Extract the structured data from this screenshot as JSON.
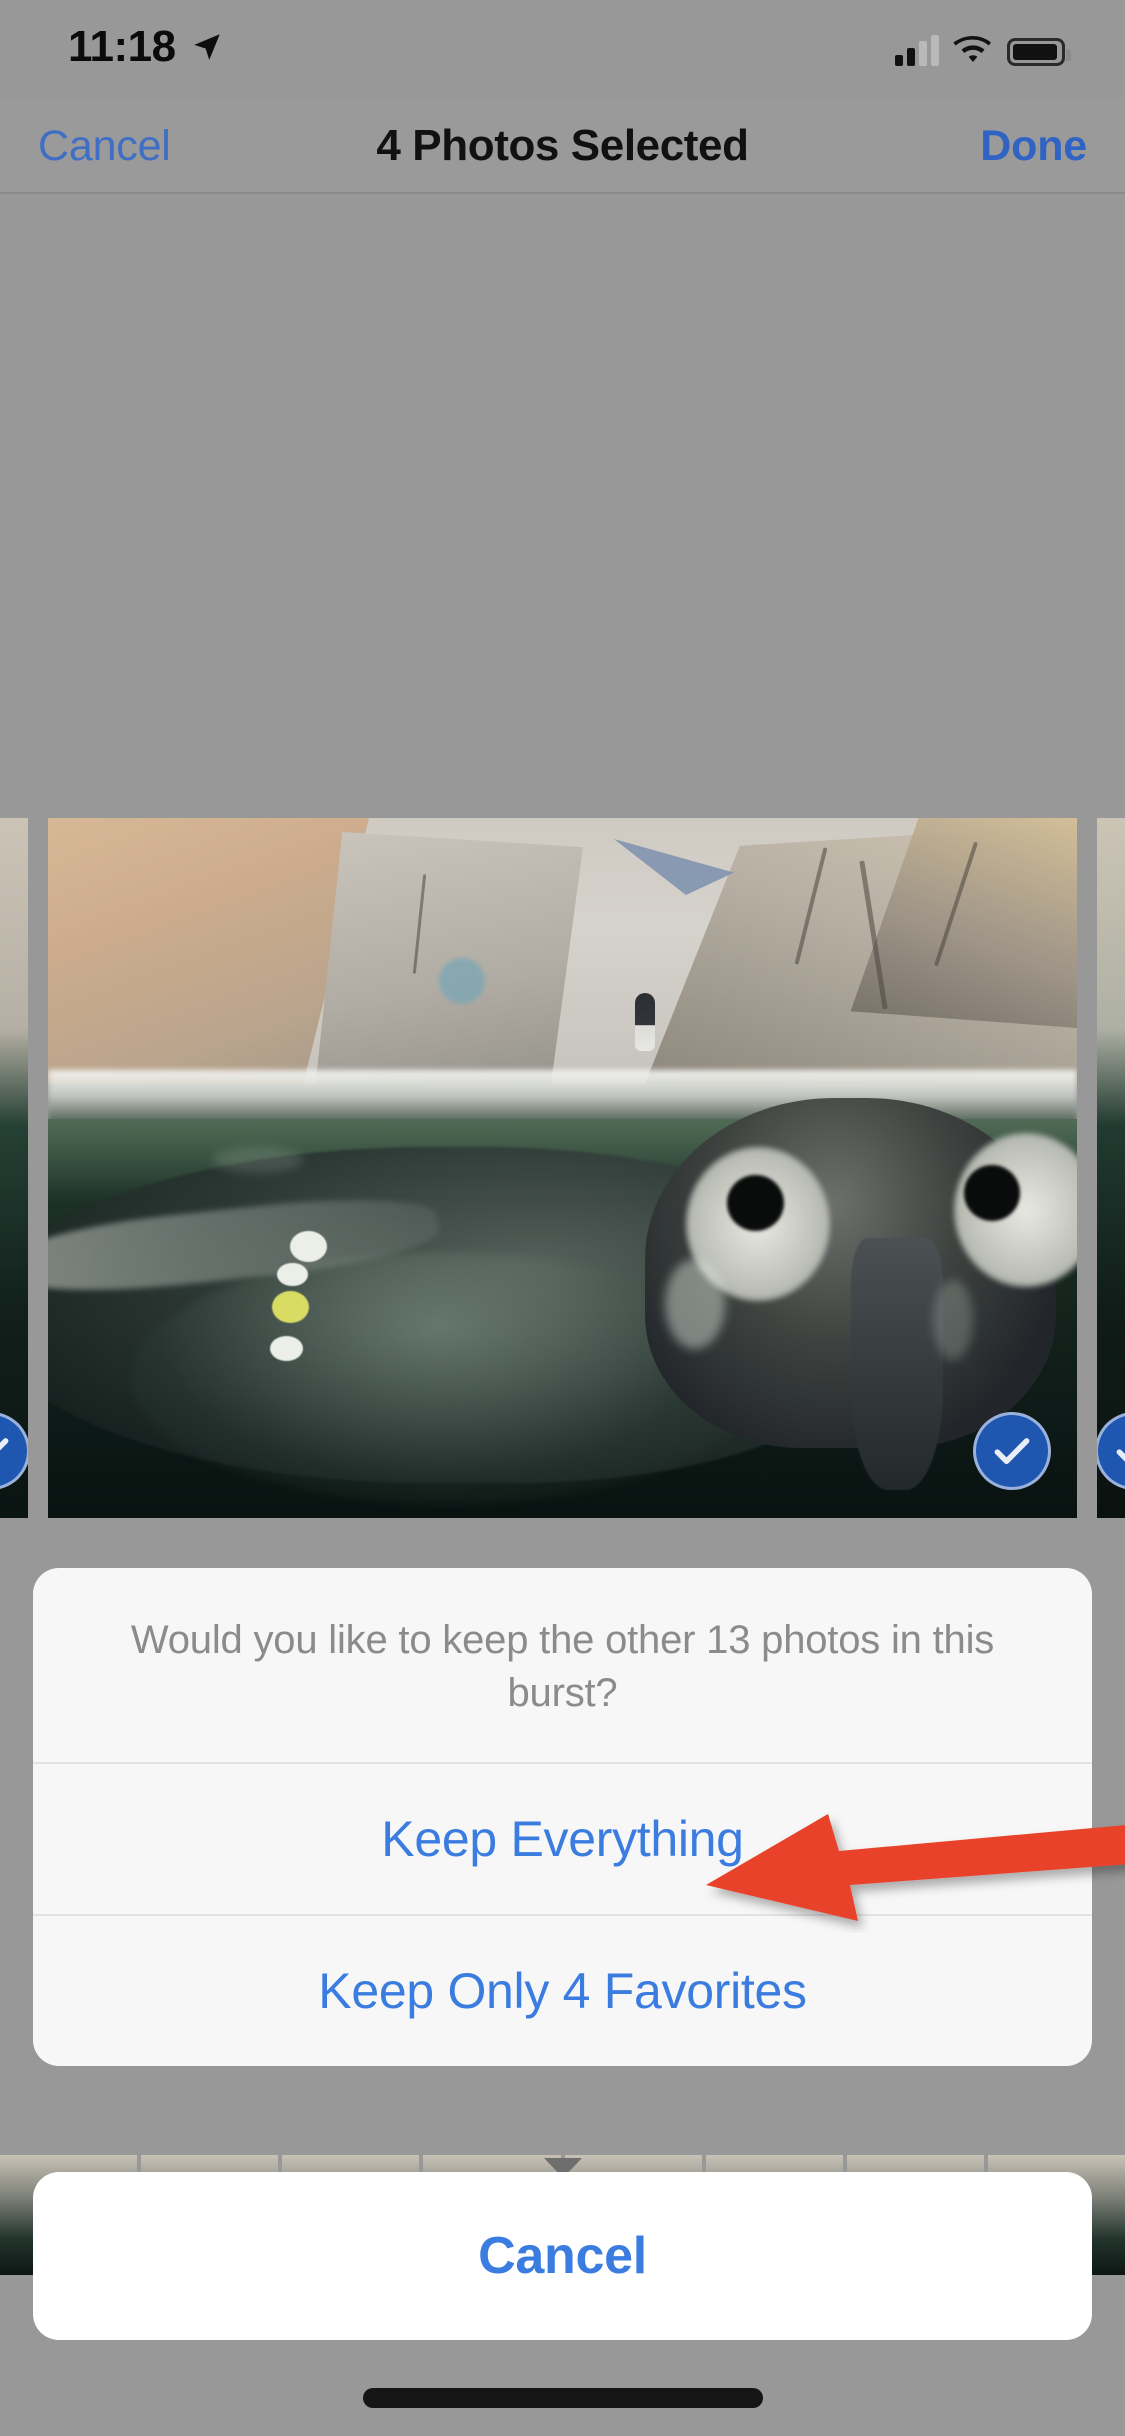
{
  "status_bar": {
    "time": "11:18",
    "location_icon": "location-arrow-icon",
    "cellular_icon": "signal-bars-icon",
    "wifi_icon": "wifi-icon",
    "battery_icon": "battery-icon"
  },
  "nav_bar": {
    "cancel_label": "Cancel",
    "title": "4 Photos Selected",
    "done_label": "Done"
  },
  "photo_viewer": {
    "selected_badge_icon": "checkmark-circle-icon",
    "main_photo_alt": "penguin underwater at zoo enclosure",
    "side_photo_left_alt": "burst photo previous frame",
    "side_photo_right_alt": "burst photo next frame"
  },
  "action_sheet": {
    "message": "Would you like to keep the other 13 photos in this burst?",
    "buttons": [
      {
        "label": "Keep Everything"
      },
      {
        "label": "Keep Only 4 Favorites"
      }
    ],
    "cancel_label": "Cancel"
  },
  "annotation": {
    "arrow_icon": "left-arrow-annotation",
    "arrow_color": "#E8422A",
    "points_at": "Keep Everything"
  },
  "colors": {
    "background_dim": "#989898",
    "tint_blue": "#3b7ce0",
    "nav_blue": "#3f6fc4",
    "sheet_background": "#f7f7f7",
    "cancel_background": "#ffffff",
    "message_gray": "#8b8b8b",
    "badge_blue": "#1f56b0",
    "annotation_red": "#E8422A"
  },
  "home_indicator": {
    "label": "home-indicator"
  }
}
